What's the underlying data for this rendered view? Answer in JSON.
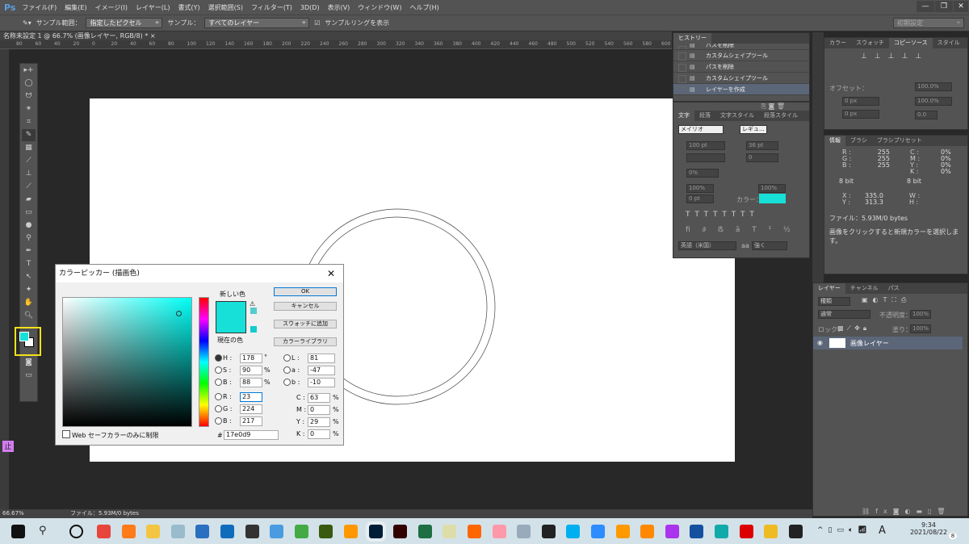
{
  "app": {
    "logo": "Ps",
    "menu": [
      "ファイル(F)",
      "編集(E)",
      "イメージ(I)",
      "レイヤー(L)",
      "書式(Y)",
      "選択範囲(S)",
      "フィルター(T)",
      "3D(D)",
      "表示(V)",
      "ウィンドウ(W)",
      "ヘルプ(H)"
    ],
    "window_buttons": [
      "—",
      "❐",
      "✕"
    ]
  },
  "options": {
    "sample_size_label": "サンプル範囲：",
    "sample_size": "指定したピクセル",
    "sample_label": "サンプル：",
    "sample": "すべてのレイヤー",
    "show_ring": "サンプルリングを表示",
    "workspace": "初期設定"
  },
  "document": {
    "tab": "名称未設定 1 @ 66.7% (画像レイヤー, RGB/8) *",
    "close": "×",
    "ruler": [
      "80",
      "60",
      "40",
      "20",
      "0",
      "20",
      "40",
      "60",
      "80",
      "100",
      "120",
      "140",
      "160",
      "180",
      "200",
      "220",
      "240",
      "260",
      "280",
      "300",
      "320",
      "340",
      "360",
      "380",
      "400",
      "420",
      "440",
      "460",
      "480",
      "500",
      "520",
      "540",
      "560",
      "580",
      "600"
    ]
  },
  "status": {
    "zoom": "66.67%",
    "file": "ファイル：5.93M/0 bytes"
  },
  "color_picker": {
    "title": "カラーピッカー (描画色)",
    "new_label": "新しい色",
    "current_label": "現在の色",
    "ok": "OK",
    "cancel": "キャンセル",
    "add_swatch": "スウォッチに追加",
    "libraries": "カラーライブラリ",
    "H": "178",
    "S": "90",
    "B": "88",
    "R": "23",
    "G": "224",
    "Bv": "217",
    "L": "81",
    "a": "-47",
    "b": "-10",
    "C": "63",
    "M": "0",
    "Y": "29",
    "K": "0",
    "hex": "17e0d9",
    "web_only": "Web セーフカラーのみに制限",
    "labels": {
      "H": "H :",
      "S": "S :",
      "B": "B :",
      "R": "R :",
      "G": "G :",
      "Bl": "B :",
      "L": "L :",
      "a": "a :",
      "b": "b :",
      "C": "C :",
      "M": "M :",
      "Y": "Y :",
      "K": "K :",
      "hash": "#",
      "deg": "°",
      "pct": "%"
    },
    "color": "#17e0d9"
  },
  "history": {
    "tab": "ヒストリー",
    "items": [
      "パスを削除",
      "カスタムシェイプツール",
      "パスを削除",
      "カスタムシェイプツール",
      "レイヤーを作成"
    ]
  },
  "character": {
    "tabs": [
      "文字",
      "段落",
      "文字スタイル",
      "段落スタイル"
    ],
    "font": "メイリオ",
    "style": "レギュ...",
    "size": "100 pt",
    "leading": "36 pt",
    "tracking": "0",
    "scale_pct": "0%",
    "vscale": "100%",
    "hscale": "100%",
    "baseline": "0 pt",
    "color_label": "カラー：",
    "language": "英語（米国）",
    "aa": "強く",
    "aa_icon": "aa"
  },
  "clone_source": {
    "tabs": [
      "カラー",
      "スウォッチ",
      "コピーソース",
      "スタイル"
    ],
    "offset": "オフセット：",
    "x": "0 px",
    "y": "0 px",
    "w": "100.0%",
    "h": "100.0%",
    "angle": "0.0"
  },
  "info": {
    "tabs": [
      "情報",
      "ブラシ",
      "ブラシプリセット"
    ],
    "R": "255",
    "G": "255",
    "B": "255",
    "C": "0%",
    "M": "0%",
    "Y": "0%",
    "K": "0%",
    "bit1": "8 bit",
    "bit2": "8 bit",
    "X": "335.0",
    "Yv": "313.3",
    "file": "ファイル：5.93M/0 bytes",
    "hint": "画像をクリックすると新規カラーを選択します。"
  },
  "layers": {
    "tabs": [
      "レイヤー",
      "チャンネル",
      "パス"
    ],
    "filter": "種類",
    "blend": "通常",
    "opacity_label": "不透明度：",
    "opacity": "100%",
    "lock_label": "ロック：",
    "fill_label": "塗り：",
    "fill": "100%",
    "items": [
      {
        "name": "画像レイヤー"
      }
    ]
  },
  "taskbar": {
    "time": "9:34",
    "date": "2021/08/22",
    "ime": "A",
    "notifications": "8",
    "apps": [
      "chrome",
      "firefox",
      "explorer",
      "notepad",
      "photos",
      "outlook",
      "settings",
      "contacts",
      "ftp",
      "dreamweaver",
      "sublime",
      "photoshop",
      "illustrator",
      "excel",
      "editor",
      "butterfly",
      "snipping",
      "paint",
      "7zip",
      "skype",
      "zoom",
      "player",
      "vlc",
      "app",
      "music",
      "app2",
      "recorder",
      "app3",
      "sticky"
    ]
  }
}
